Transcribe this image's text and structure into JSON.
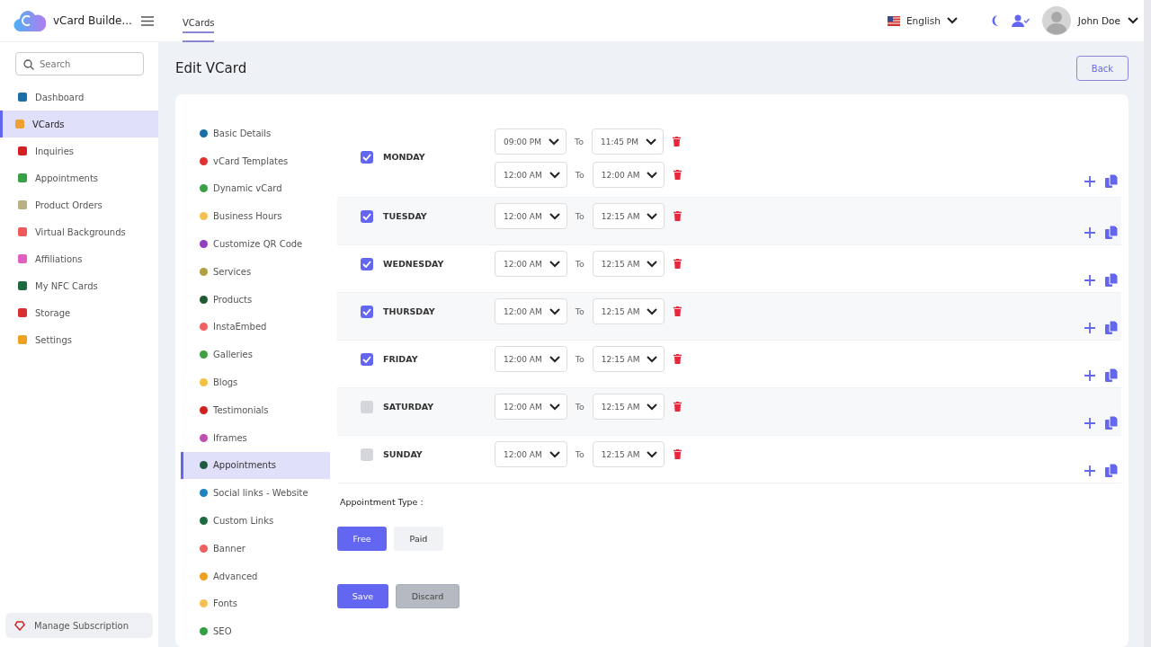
{
  "brand": {
    "name": "vCard Builde..."
  },
  "top_tabs": [
    {
      "label": "VCards",
      "selected": true
    }
  ],
  "language": {
    "label": "English"
  },
  "user": {
    "name": "John Doe"
  },
  "search": {
    "placeholder": "Search"
  },
  "sidebar": {
    "items": [
      {
        "label": "Dashboard",
        "selected": false,
        "color": "#1a6fa8"
      },
      {
        "label": "VCards",
        "selected": true,
        "color": "#f0a030"
      },
      {
        "label": "Inquiries",
        "selected": false,
        "color": "#d42020"
      },
      {
        "label": "Appointments",
        "selected": false,
        "color": "#3aa045"
      },
      {
        "label": "Product Orders",
        "selected": false,
        "color": "#b8b080"
      },
      {
        "label": "Virtual Backgrounds",
        "selected": false,
        "color": "#f05a5a"
      },
      {
        "label": "Affiliations",
        "selected": false,
        "color": "#e060c0"
      },
      {
        "label": "My NFC Cards",
        "selected": false,
        "color": "#1e6a40"
      },
      {
        "label": "Storage",
        "selected": false,
        "color": "#d83030"
      },
      {
        "label": "Settings",
        "selected": false,
        "color": "#f0a020"
      }
    ],
    "footer": "Manage Subscription"
  },
  "page": {
    "title": "Edit VCard",
    "back": "Back"
  },
  "sections": [
    {
      "label": "Basic Details",
      "selected": false,
      "color": "#1a6fa8"
    },
    {
      "label": "vCard Templates",
      "selected": false,
      "color": "#e03030"
    },
    {
      "label": "Dynamic vCard",
      "selected": false,
      "color": "#3aa045"
    },
    {
      "label": "Business Hours",
      "selected": false,
      "color": "#f5c050"
    },
    {
      "label": "Customize QR Code",
      "selected": false,
      "color": "#9040c0"
    },
    {
      "label": "Services",
      "selected": false,
      "color": "#b0a040"
    },
    {
      "label": "Products",
      "selected": false,
      "color": "#1e5a30"
    },
    {
      "label": "InstaEmbed",
      "selected": false,
      "color": "#f06060"
    },
    {
      "label": "Galleries",
      "selected": false,
      "color": "#40a040"
    },
    {
      "label": "Blogs",
      "selected": false,
      "color": "#f5c040"
    },
    {
      "label": "Testimonials",
      "selected": false,
      "color": "#d02020"
    },
    {
      "label": "Iframes",
      "selected": false,
      "color": "#c050b0"
    },
    {
      "label": "Appointments",
      "selected": true,
      "color": "#1e5a40"
    },
    {
      "label": "Social links - Website",
      "selected": false,
      "color": "#2080c0"
    },
    {
      "label": "Custom Links",
      "selected": false,
      "color": "#1e6a40"
    },
    {
      "label": "Banner",
      "selected": false,
      "color": "#f06060"
    },
    {
      "label": "Advanced",
      "selected": false,
      "color": "#f0a020"
    },
    {
      "label": "Fonts",
      "selected": false,
      "color": "#f5c050"
    },
    {
      "label": "SEO",
      "selected": false,
      "color": "#30a040"
    }
  ],
  "days": [
    {
      "name": "MONDAY",
      "checked": true,
      "slots": [
        {
          "from": "09:00 PM",
          "sep": "To",
          "to": "11:45 PM"
        },
        {
          "from": "12:00 AM",
          "sep": "To",
          "to": "12:00 AM"
        }
      ]
    },
    {
      "name": "TUESDAY",
      "checked": true,
      "slots": [
        {
          "from": "12:00 AM",
          "sep": "To",
          "to": "12:15 AM"
        }
      ]
    },
    {
      "name": "WEDNESDAY",
      "checked": true,
      "slots": [
        {
          "from": "12:00 AM",
          "sep": "To",
          "to": "12:15 AM"
        }
      ]
    },
    {
      "name": "THURSDAY",
      "checked": true,
      "slots": [
        {
          "from": "12:00 AM",
          "sep": "To",
          "to": "12:15 AM"
        }
      ]
    },
    {
      "name": "FRIDAY",
      "checked": true,
      "slots": [
        {
          "from": "12:00 AM",
          "sep": "To",
          "to": "12:15 AM"
        }
      ]
    },
    {
      "name": "SATURDAY",
      "checked": false,
      "slots": [
        {
          "from": "12:00 AM",
          "sep": "To",
          "to": "12:15 AM"
        }
      ]
    },
    {
      "name": "SUNDAY",
      "checked": false,
      "slots": [
        {
          "from": "12:00 AM",
          "sep": "To",
          "to": "12:15 AM"
        }
      ]
    }
  ],
  "appointment_type": {
    "label": "Appointment Type :",
    "options": [
      {
        "label": "Free",
        "selected": true
      },
      {
        "label": "Paid",
        "selected": false
      }
    ]
  },
  "actions": {
    "save": "Save",
    "discard": "Discard"
  }
}
